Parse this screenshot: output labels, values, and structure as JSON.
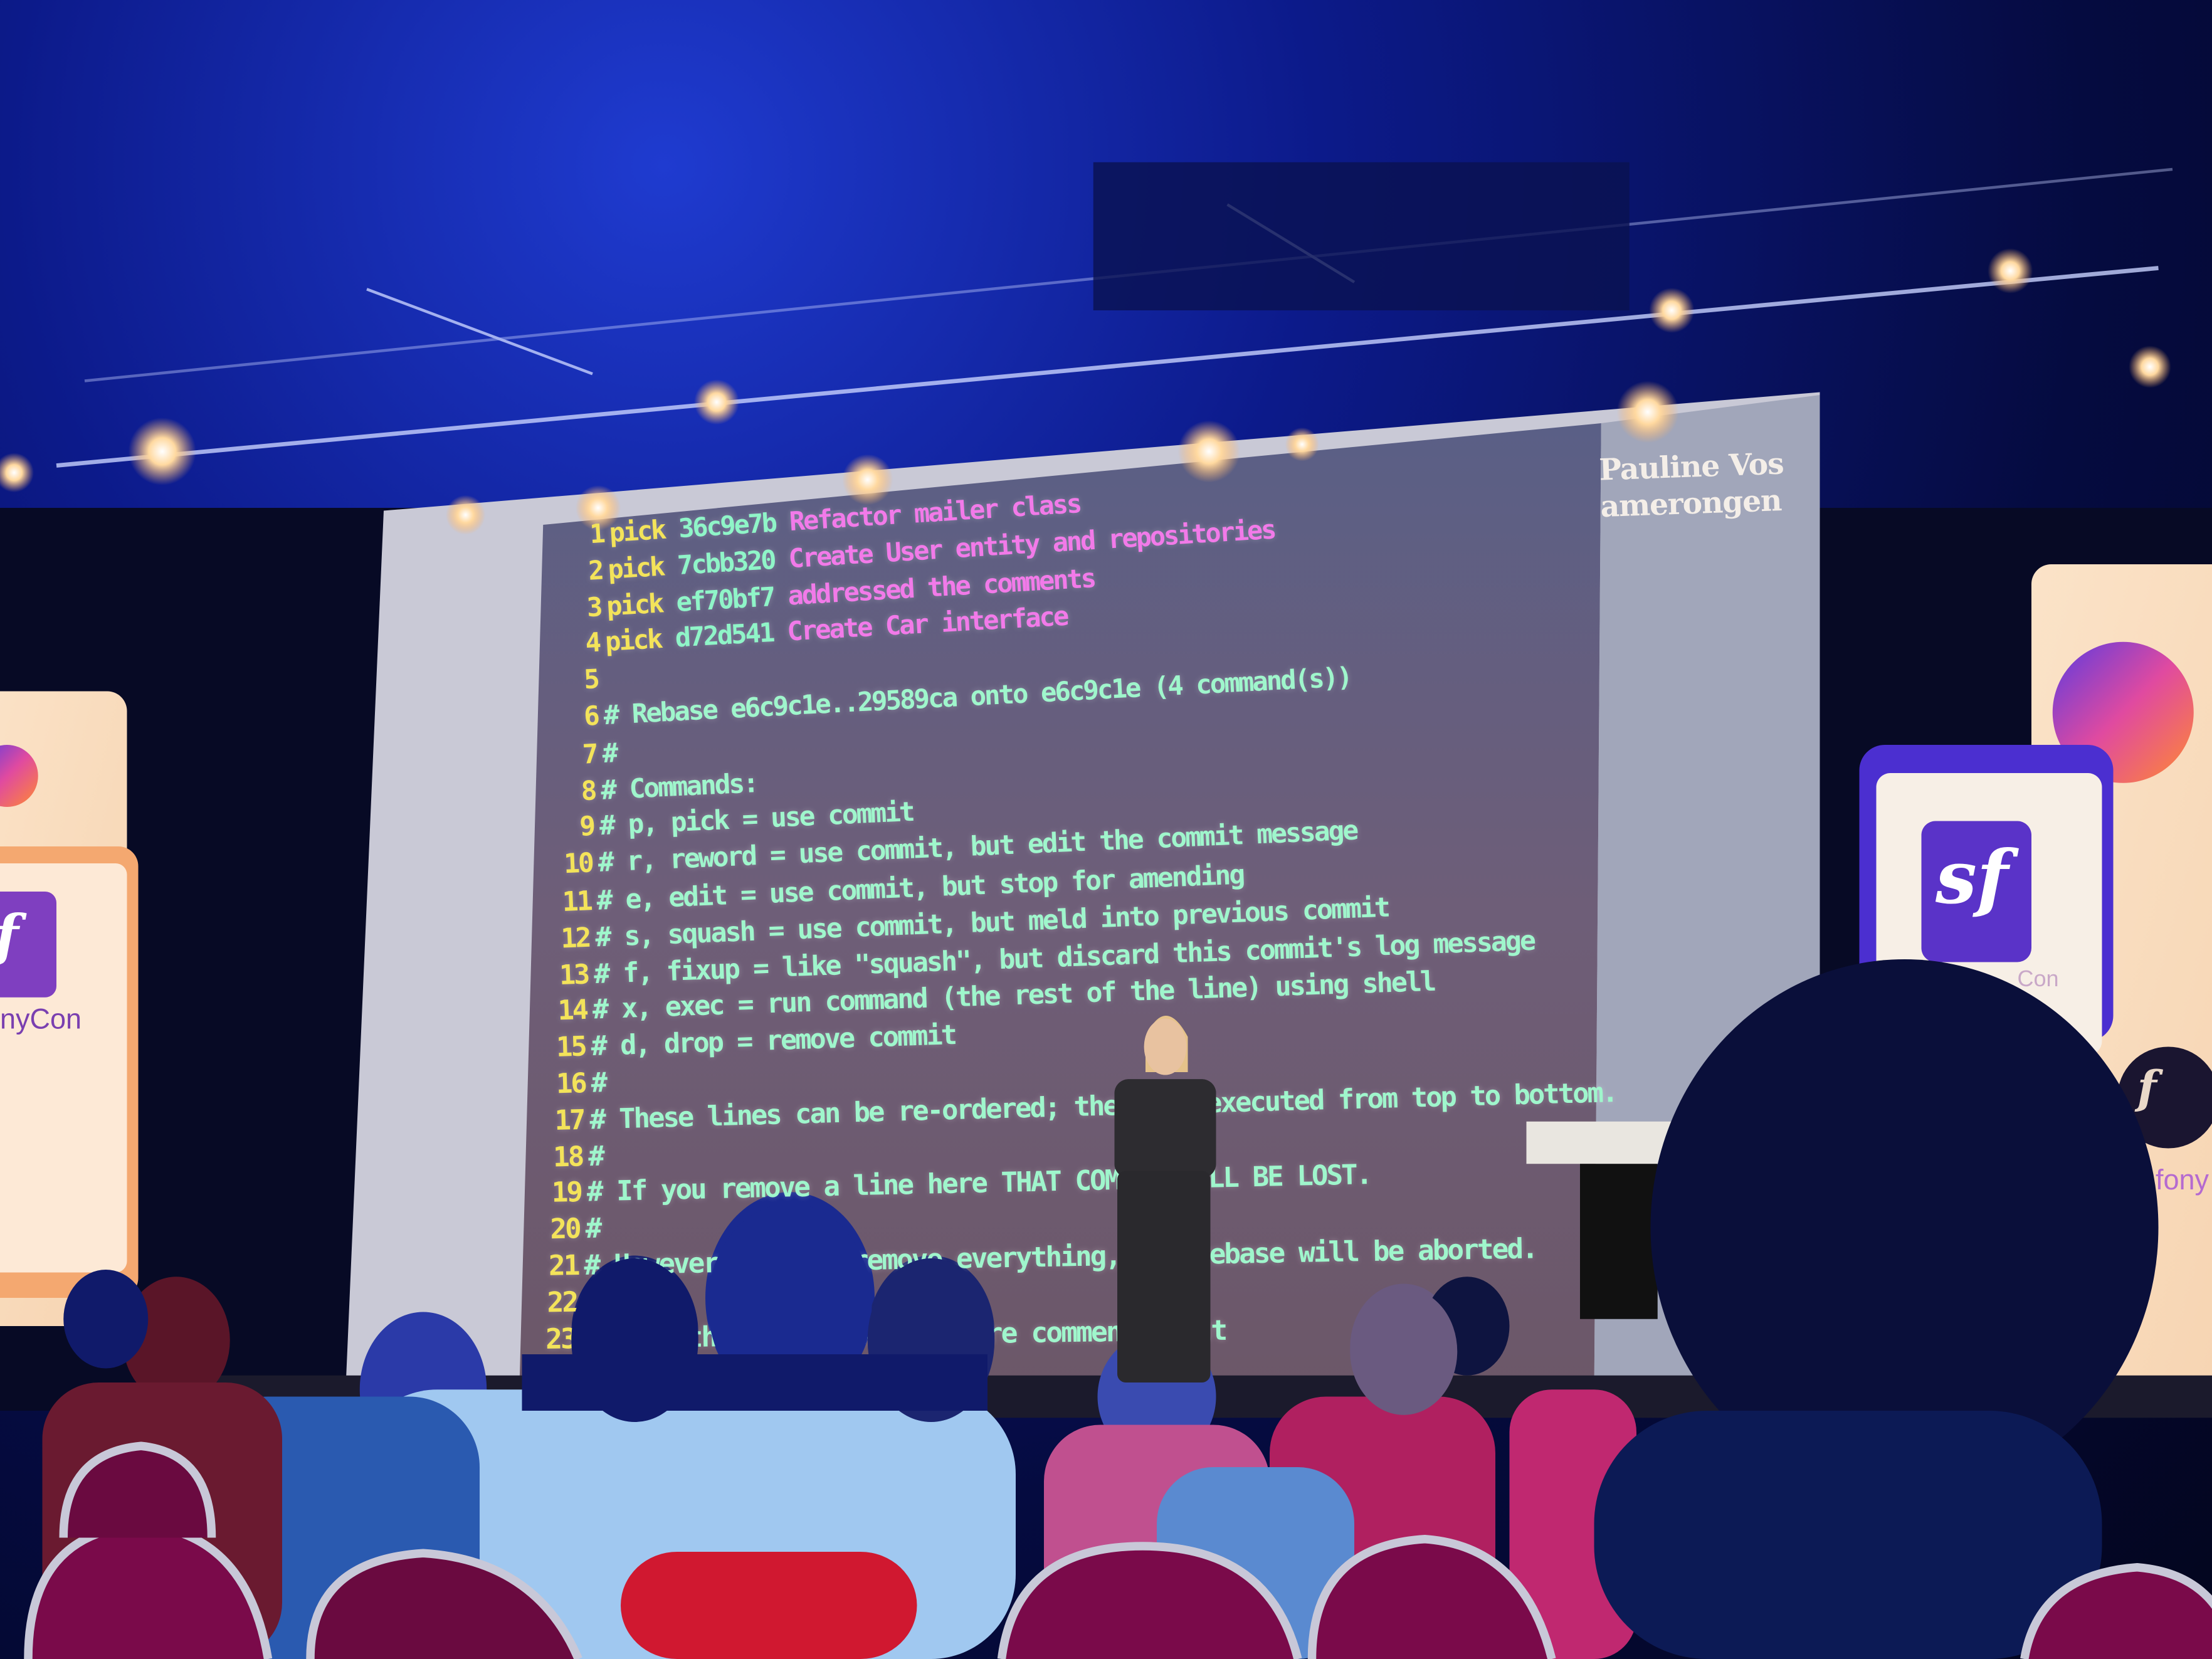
{
  "slide": {
    "speaker": [
      "Pauline Vos",
      "amerongen"
    ],
    "colors": {
      "number": "#f3e35a",
      "keyword": "#f3e35a",
      "hash": "#8ff5c8",
      "message": "#f27ae9",
      "comment": "#9ff6cc"
    },
    "lines": [
      {
        "n": "1",
        "kw": "pick",
        "hash": "36c9e7b",
        "msg": "Refactor mailer class"
      },
      {
        "n": "2",
        "kw": "pick",
        "hash": "7cbb320",
        "msg": "Create User entity and repositories"
      },
      {
        "n": "3",
        "kw": "pick",
        "hash": "ef70bf7",
        "msg": "addressed the comments"
      },
      {
        "n": "4",
        "kw": "pick",
        "hash": "d72d541",
        "msg": "Create Car interface"
      },
      {
        "n": "5",
        "text": ""
      },
      {
        "n": "6",
        "text": "# Rebase e6c9c1e..29589ca onto e6c9c1e (4 command(s))"
      },
      {
        "n": "7",
        "text": "#"
      },
      {
        "n": "8",
        "text": "# Commands:"
      },
      {
        "n": "9",
        "text": "# p, pick = use commit"
      },
      {
        "n": "10",
        "text": "# r, reword = use commit, but edit the commit message"
      },
      {
        "n": "11",
        "text": "# e, edit = use commit, but stop for amending"
      },
      {
        "n": "12",
        "text": "# s, squash = use commit, but meld into previous commit"
      },
      {
        "n": "13",
        "text": "# f, fixup = like \"squash\", but discard this commit's log message"
      },
      {
        "n": "14",
        "text": "# x, exec = run command (the rest of the line) using shell"
      },
      {
        "n": "15",
        "text": "# d, drop = remove commit"
      },
      {
        "n": "16",
        "text": "#"
      },
      {
        "n": "17",
        "text": "# These lines can be re-ordered; they are executed from top to bottom."
      },
      {
        "n": "18",
        "text": "#"
      },
      {
        "n": "19",
        "text": "# If you remove a line here THAT COMMIT WILL BE LOST."
      },
      {
        "n": "20",
        "text": "#"
      },
      {
        "n": "21",
        "text": "# However, if you remove everything, the rebase will be aborted."
      },
      {
        "n": "22",
        "text": "#"
      },
      {
        "n": "23",
        "text": "# Note that empty commits are commented out"
      }
    ]
  },
  "banners": {
    "left_text": "nyCon",
    "right_text": "fony",
    "mid_right_text": "Con",
    "logo": "sf"
  },
  "icon": "symfony-logo"
}
